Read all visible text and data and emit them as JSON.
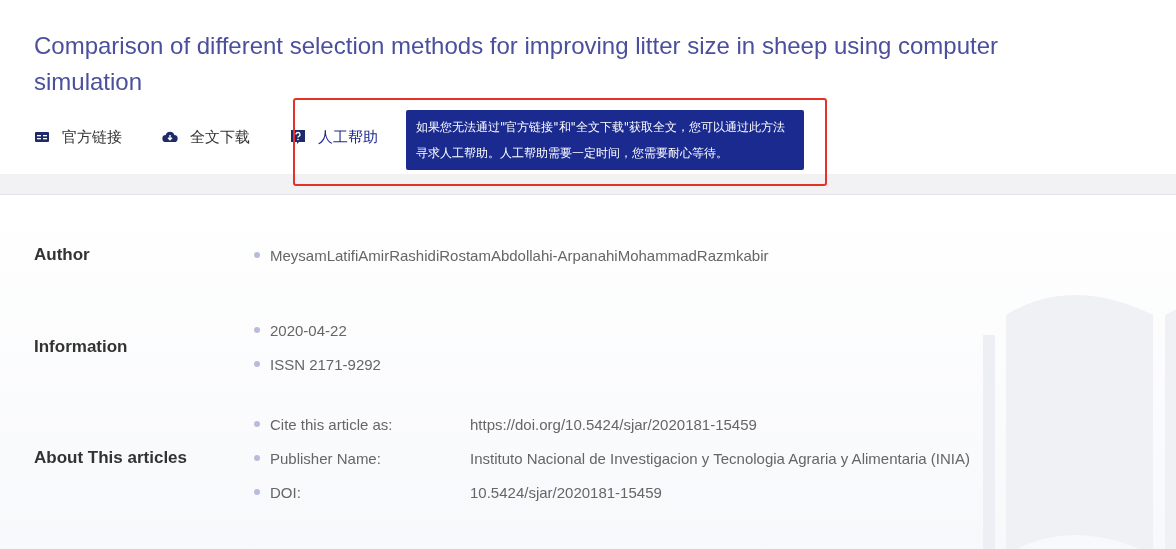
{
  "title": "Comparison of different selection methods for improving litter size in sheep using computer simulation",
  "actions": [
    {
      "kind": "link",
      "label": "官方链接",
      "selected": false
    },
    {
      "kind": "download",
      "label": "全文下载",
      "selected": false
    },
    {
      "kind": "help",
      "label": "人工帮助",
      "selected": true
    }
  ],
  "tooltip": {
    "text": "如果您无法通过\"官方链接\"和\"全文下载\"获取全文，您可以通过此方法寻求人工帮助。人工帮助需要一定时间，您需要耐心等待。"
  },
  "sections": [
    {
      "label": "Author",
      "items": [
        {
          "value": "MeysamLatifiAmirRashidiRostamAbdollahi-ArpanahiMohammadRazmkabir"
        }
      ]
    },
    {
      "label": "Information",
      "items": [
        {
          "value": "2020-04-22"
        },
        {
          "value": "ISSN 2171-9292"
        }
      ]
    },
    {
      "label": "About This articles",
      "items": [
        {
          "key": "Cite this article as:",
          "value": "https://doi.org/10.5424/sjar/2020181-15459"
        },
        {
          "key": "Publisher Name:",
          "value": "Instituto Nacional de Investigacion y Tecnologia Agraria y Alimentaria (INIA)"
        },
        {
          "key": "DOI:",
          "value": "10.5424/sjar/2020181-15459"
        }
      ]
    }
  ]
}
